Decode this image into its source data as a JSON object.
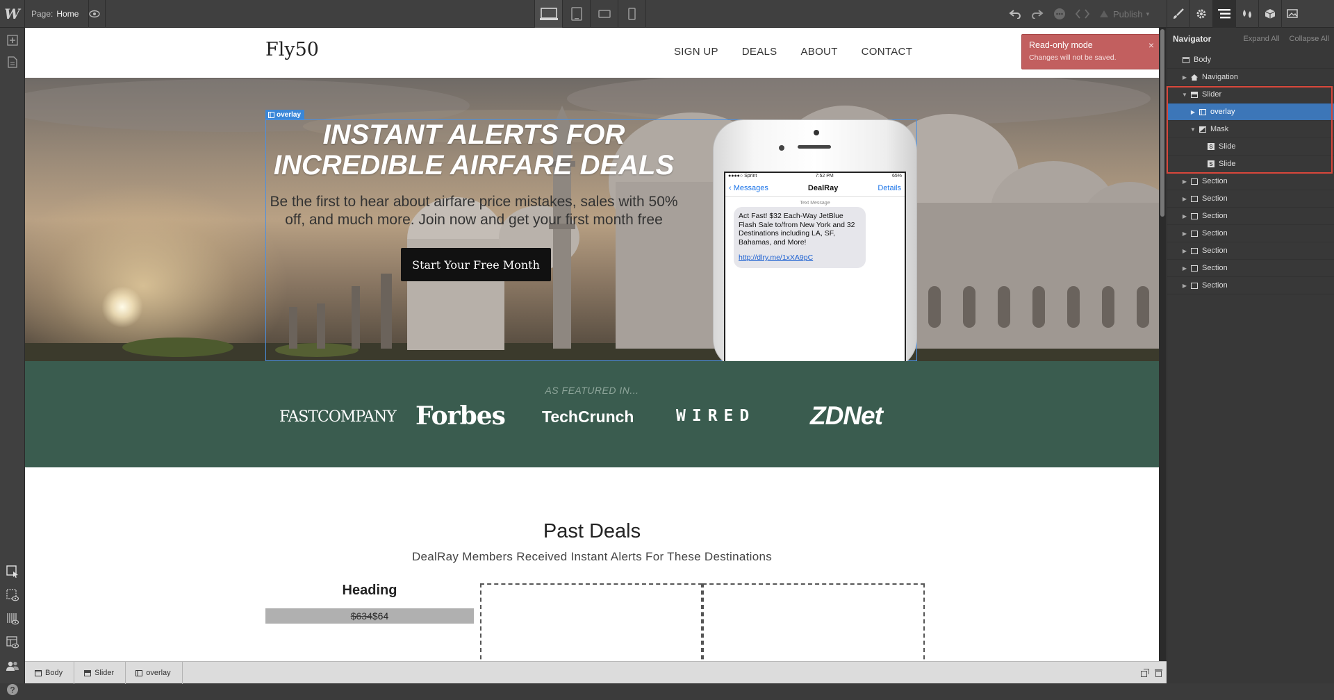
{
  "topbar": {
    "logo": "W",
    "page_label": "Page:",
    "page_name": "Home",
    "publish_label": "Publish"
  },
  "toast": {
    "title": "Read-only mode",
    "message": "Changes will not be saved.",
    "close": "×"
  },
  "site": {
    "brand": "Fly50",
    "nav": [
      "SIGN UP",
      "DEALS",
      "ABOUT",
      "CONTACT"
    ],
    "overlay_tag": "overlay",
    "hero_title_line1": "INSTANT ALERTS FOR",
    "hero_title_line2": "INCREDIBLE AIRFARE DEALS",
    "hero_sub_line1": "Be the first to hear about airfare price mistakes, sales with 50%",
    "hero_sub_line2": "off, and much more. Join now and get your first month free",
    "cta": "Start Your Free Month",
    "phone": {
      "carrier": "●●●●○ Sprint",
      "time": "7:52 PM",
      "battery": "65%",
      "back": "Messages",
      "title": "DealRay",
      "details": "Details",
      "label": "Text Message",
      "message": "Act Fast! $32 Each-Way JetBlue Flash Sale to/from New York and 32 Destinations including LA, SF, Bahamas, and More!",
      "link": "http://dlry.me/1xXA9pC"
    },
    "featured_label": "AS FEATURED IN...",
    "press": [
      "FASTCOMPANY",
      "Forbes",
      "TechCrunch",
      "WIRED",
      "ZDNet"
    ],
    "deals_title": "Past Deals",
    "deals_sub": "DealRay Members Received Instant Alerts For These Destinations",
    "deal_heading": "Heading",
    "deal_old_price": "$634",
    "deal_new_price": "$64"
  },
  "breadcrumb": [
    "Body",
    "Slider",
    "overlay"
  ],
  "navigator": {
    "title": "Navigator",
    "expand_all": "Expand All",
    "collapse_all": "Collapse All",
    "tree": [
      {
        "label": "Body"
      },
      {
        "label": "Navigation"
      },
      {
        "label": "Slider"
      },
      {
        "label": "overlay"
      },
      {
        "label": "Mask"
      },
      {
        "label": "Slide"
      },
      {
        "label": "Slide"
      },
      {
        "label": "Section"
      },
      {
        "label": "Section"
      },
      {
        "label": "Section"
      },
      {
        "label": "Section"
      },
      {
        "label": "Section"
      },
      {
        "label": "Section"
      },
      {
        "label": "Section"
      }
    ]
  },
  "colors": {
    "featured_bg": "#3a5c4f",
    "selection": "#3c76b8",
    "highlight_box": "#d9473b",
    "toast_bg": "#c25f5f"
  }
}
